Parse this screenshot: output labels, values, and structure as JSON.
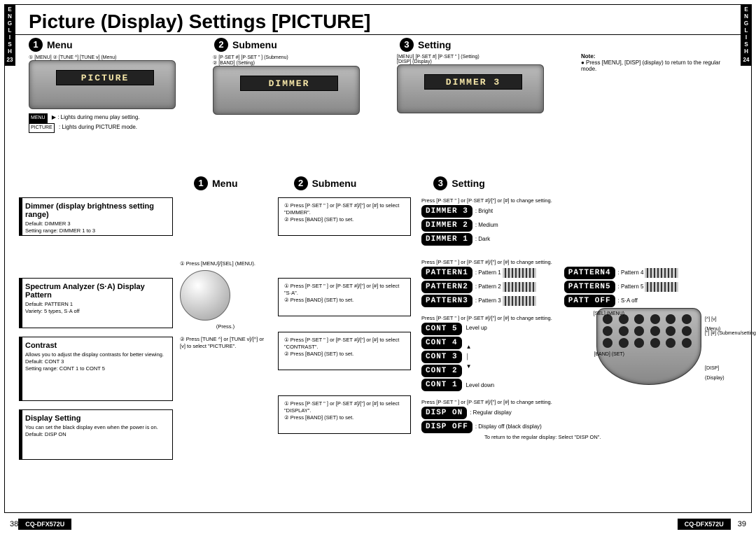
{
  "title": "Picture (Display) Settings [PICTURE]",
  "side_left": {
    "lang": "ENGLISH",
    "page": "23"
  },
  "side_right": {
    "lang": "ENGLISH",
    "page": "24"
  },
  "heads": {
    "h1": "Menu",
    "h2": "Submenu",
    "h3": "Setting"
  },
  "lcd": {
    "menu": "PICTURE",
    "submenu": "DIMMER",
    "setting": "DIMMER 3"
  },
  "caps": {
    "menu_a": "① [MENU]   ② [TUNE ^] [TUNE v] (Menu)",
    "sub_a": "① [P·SET #] [P·SET \" ] (Submenu)",
    "sub_b": "② [BAND] (Setting)",
    "set_a": "[MENU]              [P·SET #] [P·SET \" ] (Setting)",
    "set_b": "[DISP] (Display)"
  },
  "legend": {
    "l1": ": Lights during menu play setting.",
    "l2": ": Lights during PICTURE mode."
  },
  "note": {
    "title": "Note:",
    "line": "● Press [MENU], [DISP] (display) to return to the regular mode."
  },
  "box_dimmer": {
    "title": "Dimmer (display brightness setting range)",
    "d1": "Default: DIMMER 3",
    "d2": "Setting range: DIMMER 1 to 3"
  },
  "box_sa": {
    "title": "Spectrum Analyzer (S·A) Display Pattern",
    "d1": "Default: PATTERN 1",
    "d2": "Variety: 5 types, S·A off"
  },
  "box_cont": {
    "title": "Contrast",
    "desc": "Allows you to adjust the display contrasts for better viewing.",
    "d1": "Default: CONT 3",
    "d2": "Setting range: CONT 1 to CONT 5"
  },
  "box_disp": {
    "title": "Display Setting",
    "desc": "You can set the black display even when the power is on.",
    "d1": "Default: DISP ON"
  },
  "knob": {
    "a": "① Press [MENU]/[SEL] (MENU).",
    "press": "(Press.)",
    "b": "② Press [TUNE ^] or [TUNE v]/[^] or [v] to select \"PICTURE\"."
  },
  "sub_dimmer": {
    "a": "① Press [P·SET \" ] or [P·SET #]/[\"] or [#] to select \"DIMMER\".",
    "b": "② Press [BAND] (SET) to set."
  },
  "sub_sa": {
    "a": "① Press [P·SET \" ] or [P·SET #]/[\"] or [#] to select \"S·A\".",
    "b": "② Press [BAND] (SET) to set."
  },
  "sub_cont": {
    "a": "① Press [P·SET \" ] or [P·SET #]/[\"] or [#] to select \"CONTRAST\".",
    "b": "② Press [BAND] (SET) to set."
  },
  "sub_disp": {
    "a": "① Press [P·SET \" ] or [P·SET #]/[\"] or [#] to select \"DISPLAY\".",
    "b": "② Press [BAND] (SET) to set."
  },
  "set_intro": "Press [P·SET \" ] or [P·SET #]/[\"] or [#] to change setting.",
  "set_intro2": "Press [P·SET \" ] or [P·SET #]/[\"] or [#] to change setting.",
  "dimmer": {
    "d3": {
      "chip": "DIMMER 3",
      "label": ": Bright"
    },
    "d2": {
      "chip": "DIMMER 2",
      "label": ": Medium"
    },
    "d1": {
      "chip": "DIMMER 1",
      "label": ": Dark"
    }
  },
  "patterns": {
    "p1": {
      "chip": "PATTERN1",
      "label": ": Pattern 1"
    },
    "p2": {
      "chip": "PATTERN2",
      "label": ": Pattern 2"
    },
    "p3": {
      "chip": "PATTERN3",
      "label": ": Pattern 3"
    },
    "p4": {
      "chip": "PATTERN4",
      "label": ": Pattern 4"
    },
    "p5": {
      "chip": "PATTERN5",
      "label": ": Pattern 5"
    },
    "off": {
      "chip": "PATT OFF",
      "label": ": S·A off"
    }
  },
  "cont": {
    "c5": "CONT 5",
    "c4": "CONT 4",
    "c3": "CONT 3",
    "c2": "CONT 2",
    "c1": "CONT 1",
    "up": "Level up",
    "down": "Level down"
  },
  "disp": {
    "on": {
      "chip": "DISP ON",
      "label": ": Regular display"
    },
    "off": {
      "chip": "DISP OFF",
      "label": ": Display off (black display)"
    },
    "ret": "To return to the regular display: Select \"DISP ON\"."
  },
  "remote": {
    "sel": "[SEL] (MENU)",
    "band": "[BAND] (SET)",
    "menu": "[^] [v] (Menu)",
    "sub": "[\"] [#] (Submenu/setting)",
    "disp": "[DISP] (Display)"
  },
  "footer": {
    "left_page": "38",
    "right_page": "39",
    "model": "CQ-DFX572U"
  }
}
